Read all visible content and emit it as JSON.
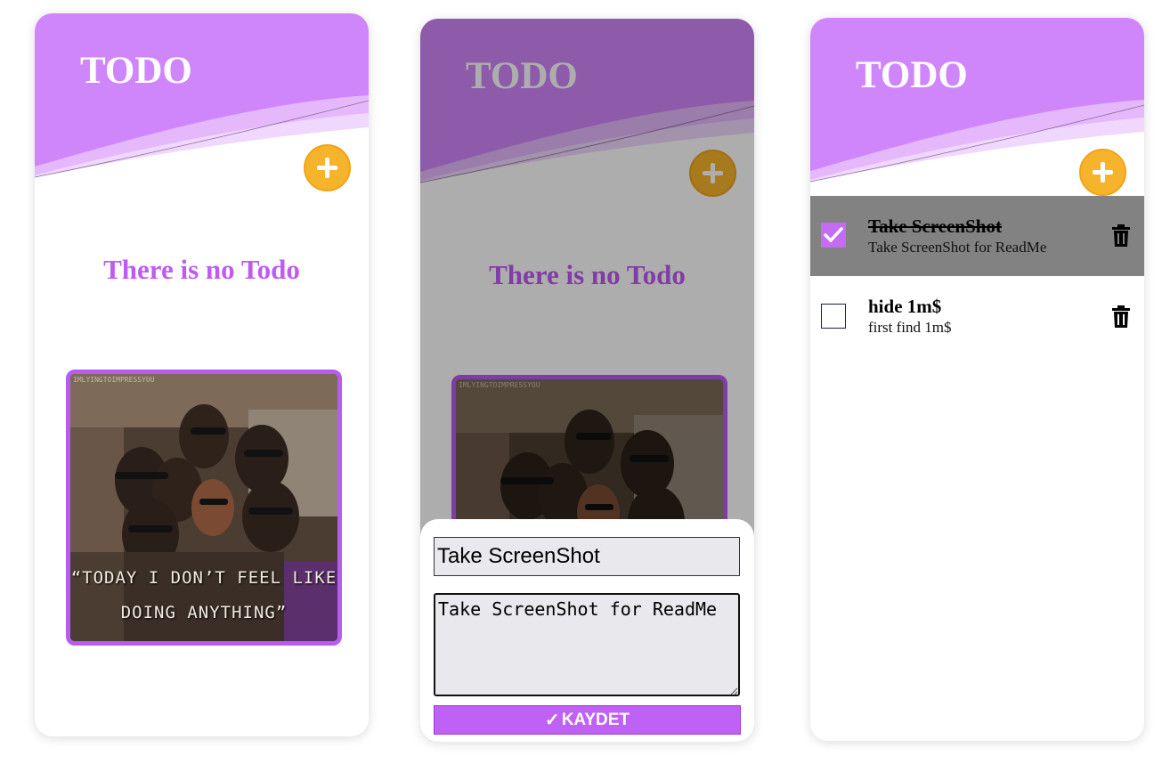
{
  "colors": {
    "header_purple": "#d086fb",
    "accent_purple": "#bf5af2",
    "fab_orange": "#f6b42c",
    "done_row_gray": "#828282",
    "overlay": "rgba(0,0,0,0.32)"
  },
  "screens": [
    {
      "app_title": "TODO",
      "empty_message": "There is no Todo",
      "gif": {
        "caption_line1": "“TODAY I DON’T FEEL LIKE",
        "caption_line2": "DOING ANYTHING”",
        "watermark": "IMLYINGTOIMPRESSYOU"
      },
      "add_icon": "plus-icon"
    },
    {
      "app_title": "TODO",
      "empty_message": "There is no Todo",
      "gif": {
        "watermark": "IMLYINGTOIMPRESSYOU"
      },
      "add_icon": "plus-icon",
      "form": {
        "title_value": "Take ScreenShot",
        "description_value": "Take ScreenShot for ReadMe",
        "save_label": "KAYDET",
        "save_icon": "checkmark-icon"
      }
    },
    {
      "app_title": "TODO",
      "add_icon": "plus-icon",
      "todos": [
        {
          "title": "Take ScreenShot",
          "description": "Take ScreenShot for ReadMe",
          "completed": true
        },
        {
          "title": "hide 1m$",
          "description": "first find 1m$",
          "completed": false
        }
      ],
      "delete_icon": "trash-icon"
    }
  ]
}
